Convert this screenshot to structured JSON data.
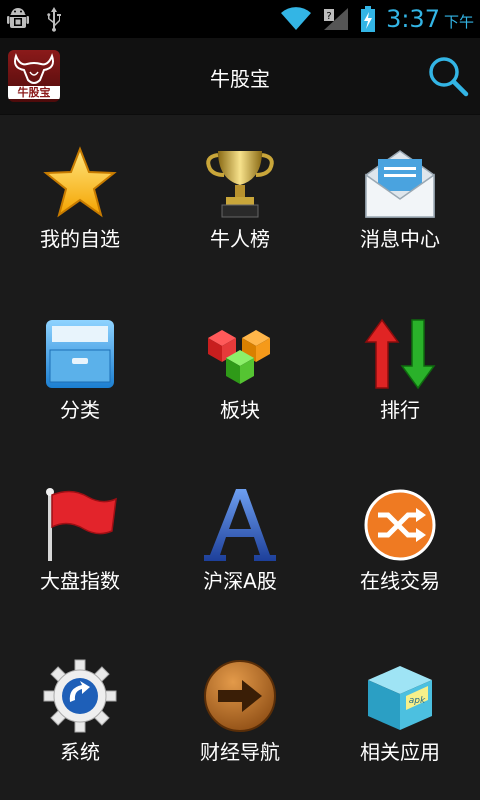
{
  "status": {
    "time": "3:37",
    "ampm": "下午"
  },
  "app": {
    "title": "牛股宝",
    "logo_text": "牛股宝"
  },
  "grid": [
    {
      "label": "我的自选",
      "icon": "star-icon"
    },
    {
      "label": "牛人榜",
      "icon": "trophy-icon"
    },
    {
      "label": "消息中心",
      "icon": "envelope-icon"
    },
    {
      "label": "分类",
      "icon": "file-drawer-icon"
    },
    {
      "label": "板块",
      "icon": "cubes-icon"
    },
    {
      "label": "排行",
      "icon": "up-down-arrows-icon"
    },
    {
      "label": "大盘指数",
      "icon": "red-flag-icon"
    },
    {
      "label": "沪深A股",
      "icon": "letter-a-icon"
    },
    {
      "label": "在线交易",
      "icon": "shuffle-icon"
    },
    {
      "label": "系统",
      "icon": "gear-icon"
    },
    {
      "label": "财经导航",
      "icon": "arrow-right-button-icon"
    },
    {
      "label": "相关应用",
      "icon": "apk-box-icon"
    }
  ]
}
